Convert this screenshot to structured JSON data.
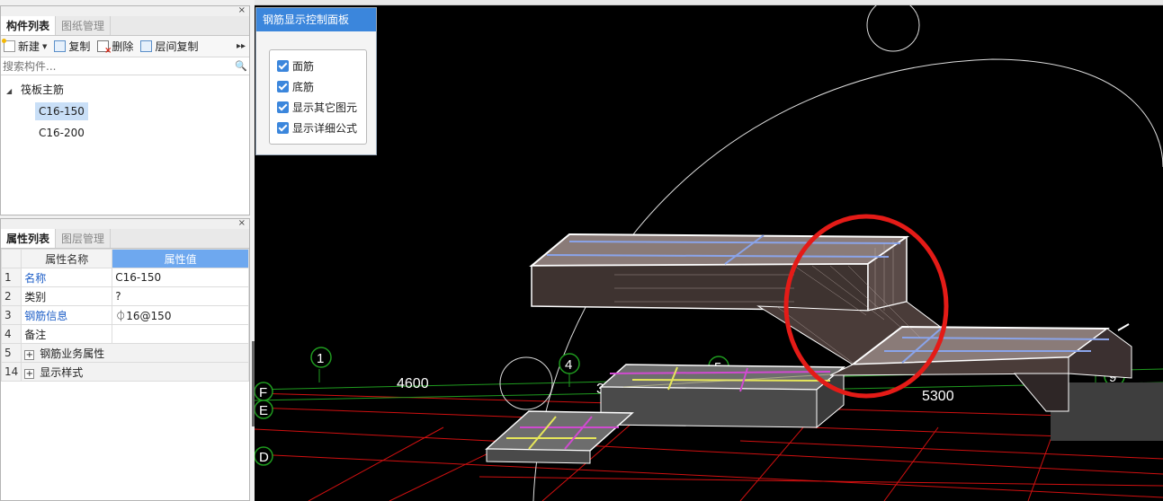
{
  "component_panel": {
    "close": "×",
    "tabs": [
      "构件列表",
      "图纸管理"
    ],
    "toolbar": {
      "new": "新建",
      "copy": "复制",
      "delete": "删除",
      "floor_copy": "层间复制",
      "more": "▸▸"
    },
    "search_placeholder": "搜索构件...",
    "tree": {
      "root": "筏板主筋",
      "children": [
        "C16-150",
        "C16-200"
      ]
    }
  },
  "property_panel": {
    "close": "×",
    "tabs": [
      "属性列表",
      "图层管理"
    ],
    "headers": {
      "name": "属性名称",
      "value": "属性值"
    },
    "rows": [
      {
        "num": "1",
        "name": "名称",
        "value": "C16-150"
      },
      {
        "num": "2",
        "name": "类别",
        "value": "?"
      },
      {
        "num": "3",
        "name": "钢筋信息",
        "value": "⏀16@150"
      },
      {
        "num": "4",
        "name": "备注",
        "value": ""
      },
      {
        "num": "5",
        "name": "钢筋业务属性",
        "value": ""
      },
      {
        "num": "14",
        "name": "显示样式",
        "value": ""
      }
    ]
  },
  "control_panel": {
    "title": "钢筋显示控制面板",
    "options": [
      "面筋",
      "底筋",
      "显示其它图元",
      "显示详细公式"
    ]
  },
  "viewport": {
    "axis_labels": {
      "a1": "1",
      "a4": "4",
      "a5": "5",
      "a9": "9",
      "aD": "D",
      "aE": "E",
      "aF": "F"
    },
    "dimensions": {
      "d1": "4600",
      "d2": "5300",
      "d3": "3"
    }
  }
}
